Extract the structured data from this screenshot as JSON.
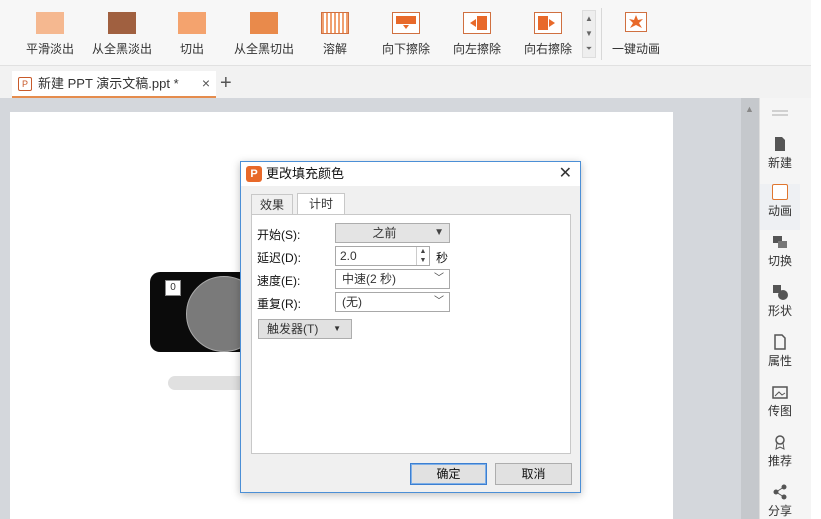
{
  "ribbon": {
    "animations": [
      {
        "label": "平滑淡出",
        "icon": "fade-out-smooth-icon"
      },
      {
        "label": "从全黑淡出",
        "icon": "fade-out-black-icon"
      },
      {
        "label": "切出",
        "icon": "cut-out-icon"
      },
      {
        "label": "从全黑切出",
        "icon": "cut-out-black-icon"
      },
      {
        "label": "溶解",
        "icon": "dissolve-icon"
      },
      {
        "label": "向下擦除",
        "icon": "wipe-down-icon"
      },
      {
        "label": "向左擦除",
        "icon": "wipe-left-icon"
      },
      {
        "label": "向右擦除",
        "icon": "wipe-right-icon"
      }
    ],
    "one_click": "一键动画"
  },
  "tabbar": {
    "doc_tab": "新建 PPT 演示文稿.ppt *",
    "close": "×",
    "add": "+"
  },
  "slide": {
    "badge": "0"
  },
  "right_panel": {
    "items": [
      {
        "label": "新建"
      },
      {
        "label": "动画"
      },
      {
        "label": "切换"
      },
      {
        "label": "形状"
      },
      {
        "label": "属性"
      },
      {
        "label": "传图"
      },
      {
        "label": "推荐"
      },
      {
        "label": "分享"
      }
    ]
  },
  "dialog": {
    "title": "更改填充颜色",
    "close": "✕",
    "tabs": [
      {
        "label": "效果"
      },
      {
        "label": "计时"
      }
    ],
    "start_label": "开始(S):",
    "start_value": "之前",
    "delay_label": "延迟(D):",
    "delay_value": "2.0",
    "delay_unit": "秒",
    "speed_label": "速度(E):",
    "speed_value": "中速(2 秒)",
    "repeat_label": "重复(R):",
    "repeat_value": "(无)",
    "trigger_label": "触发器(T)",
    "ok": "确定",
    "cancel": "取消"
  },
  "colors": {
    "accent": "#e8692a",
    "dialog_border": "#4b8fd6"
  }
}
